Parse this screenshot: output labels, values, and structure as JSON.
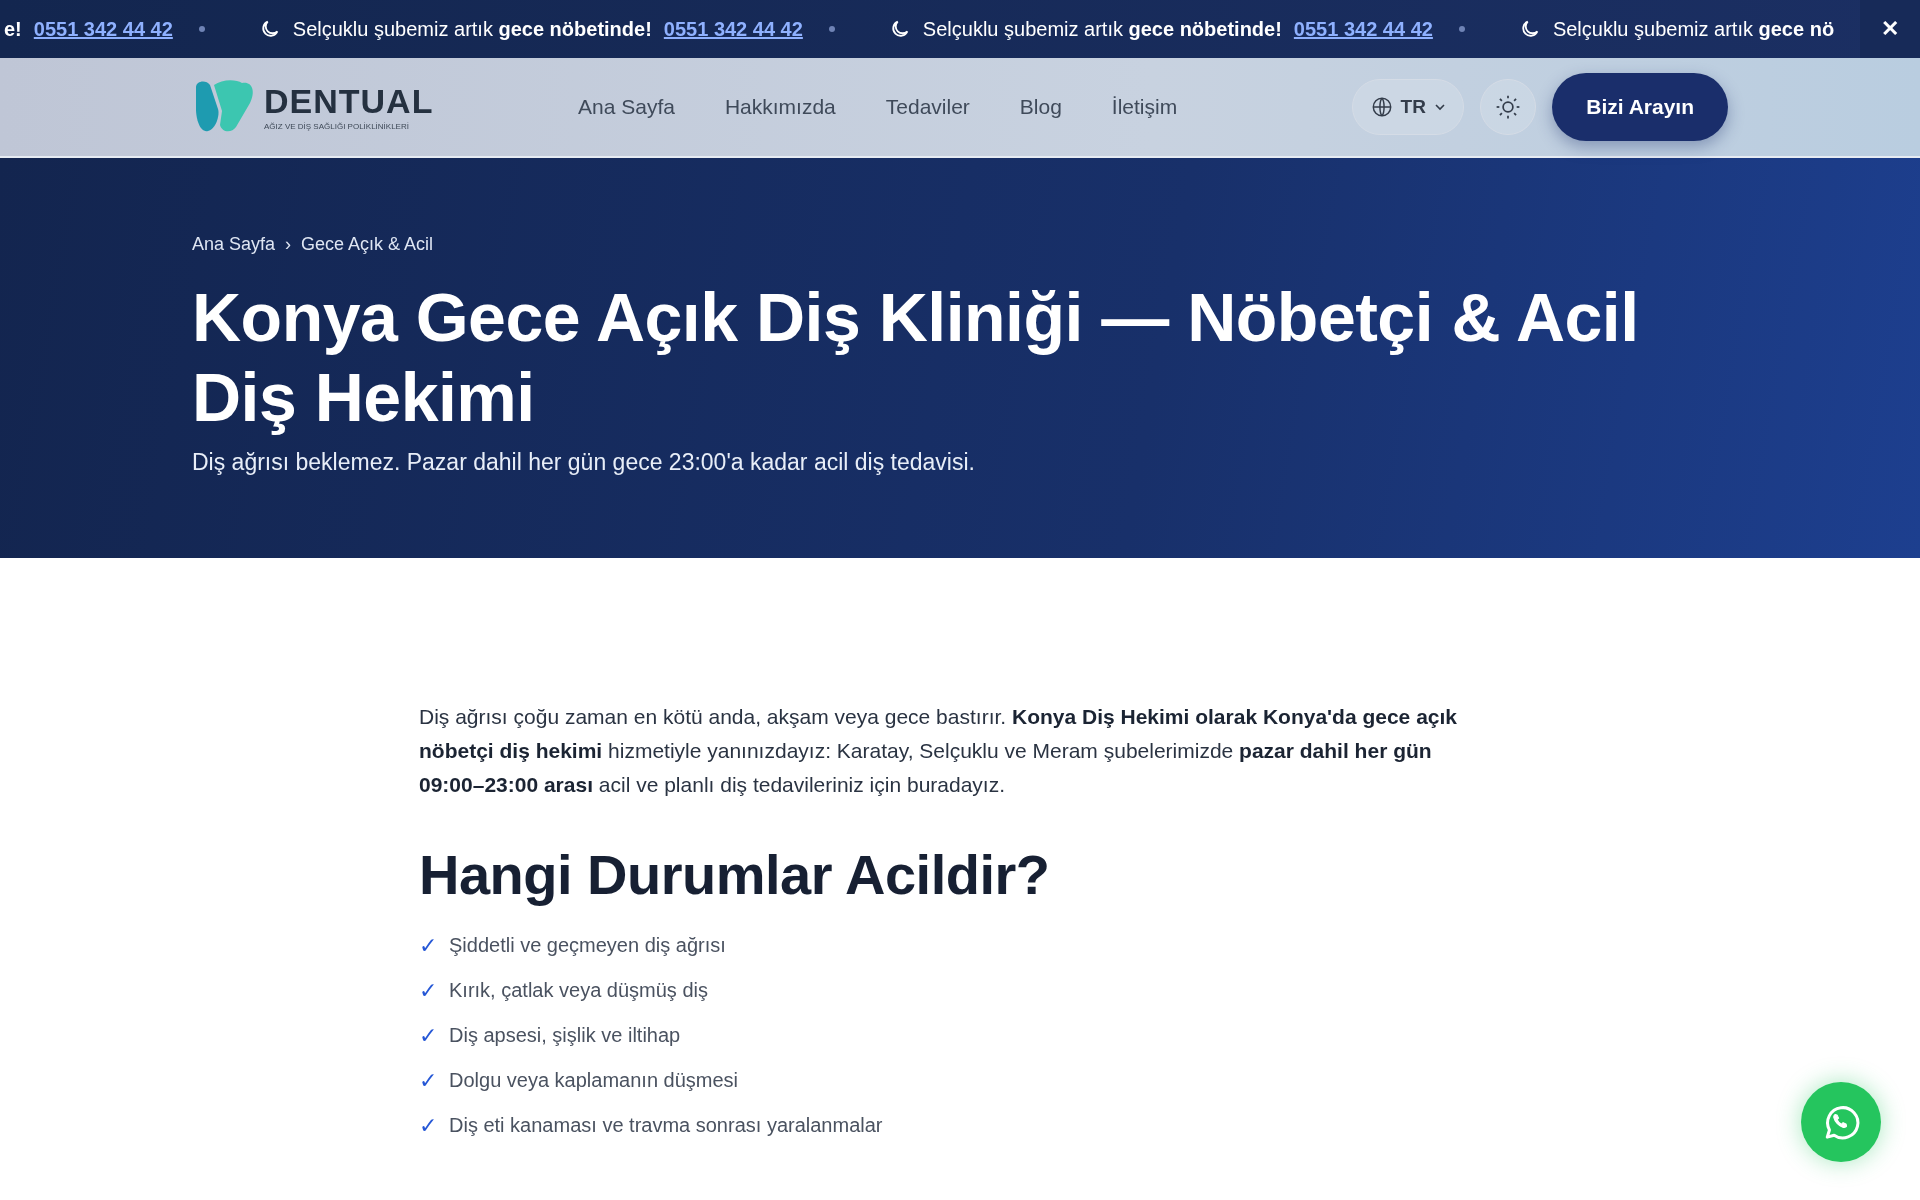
{
  "ticker": {
    "items": [
      {
        "kind": "fragment",
        "text": "**e!**",
        "phone": "0551 342 44 42"
      },
      {
        "kind": "message",
        "text": "Selçuklu şubemiz artık **gece nöbetinde!**",
        "phone": "0551 342 44 42"
      },
      {
        "kind": "message",
        "text": "Selçuklu şubemiz artık **gece nöbetinde!**",
        "phone": "0551 342 44 42"
      },
      {
        "kind": "message",
        "text": "Selçuklu şubemiz artık **gece nö**"
      }
    ],
    "close": "✕"
  },
  "header": {
    "logo": {
      "name": "DENTUAL",
      "tagline": "AĞIZ VE DİŞ SAĞLIĞI POLİKLİNİKLERİ"
    },
    "nav": [
      "Ana Sayfa",
      "Hakkımızda",
      "Tedaviler",
      "Blog",
      "İletişim"
    ],
    "language": "TR",
    "cta": "Bizi Arayın"
  },
  "hero": {
    "breadcrumb": [
      "Ana Sayfa",
      "Gece Açık & Acil"
    ],
    "separator": "›",
    "title": "Konya Gece Açık Diş Kliniği — Nöbetçi & Acil Diş Hekimi",
    "subtitle": "Diş ağrısı beklemez. Pazar dahil her gün gece 23:00'a kadar acil diş tedavisi."
  },
  "content": {
    "intro": "Diş ağrısı çoğu zaman en kötü anda, akşam veya gece bastırır. **Konya Diş Hekimi olarak Konya'da gece açık nöbetçi diş hekimi** hizmetiyle yanınızdayız: Karatay, Selçuklu ve Meram şubelerimizde **pazar dahil her gün 09:00–23:00 arası** acil ve planlı diş tedavileriniz için buradayız.",
    "heading": "Hangi Durumlar Acildir?",
    "list": [
      {
        "mark": "✓",
        "text": "Şiddetli ve geçmeyen diş ağrısı"
      },
      {
        "mark": "✓",
        "text": "Kırık, çatlak veya düşmüş diş"
      },
      {
        "mark": "✓",
        "text": "Diş apsesi, şişlik ve iltihap"
      },
      {
        "mark": "✓",
        "text": "Dolgu veya kaplamanın düşmesi"
      },
      {
        "mark": "✓",
        "text": "Diş eti kanaması ve travma sonrası yaralanmalar"
      }
    ]
  }
}
